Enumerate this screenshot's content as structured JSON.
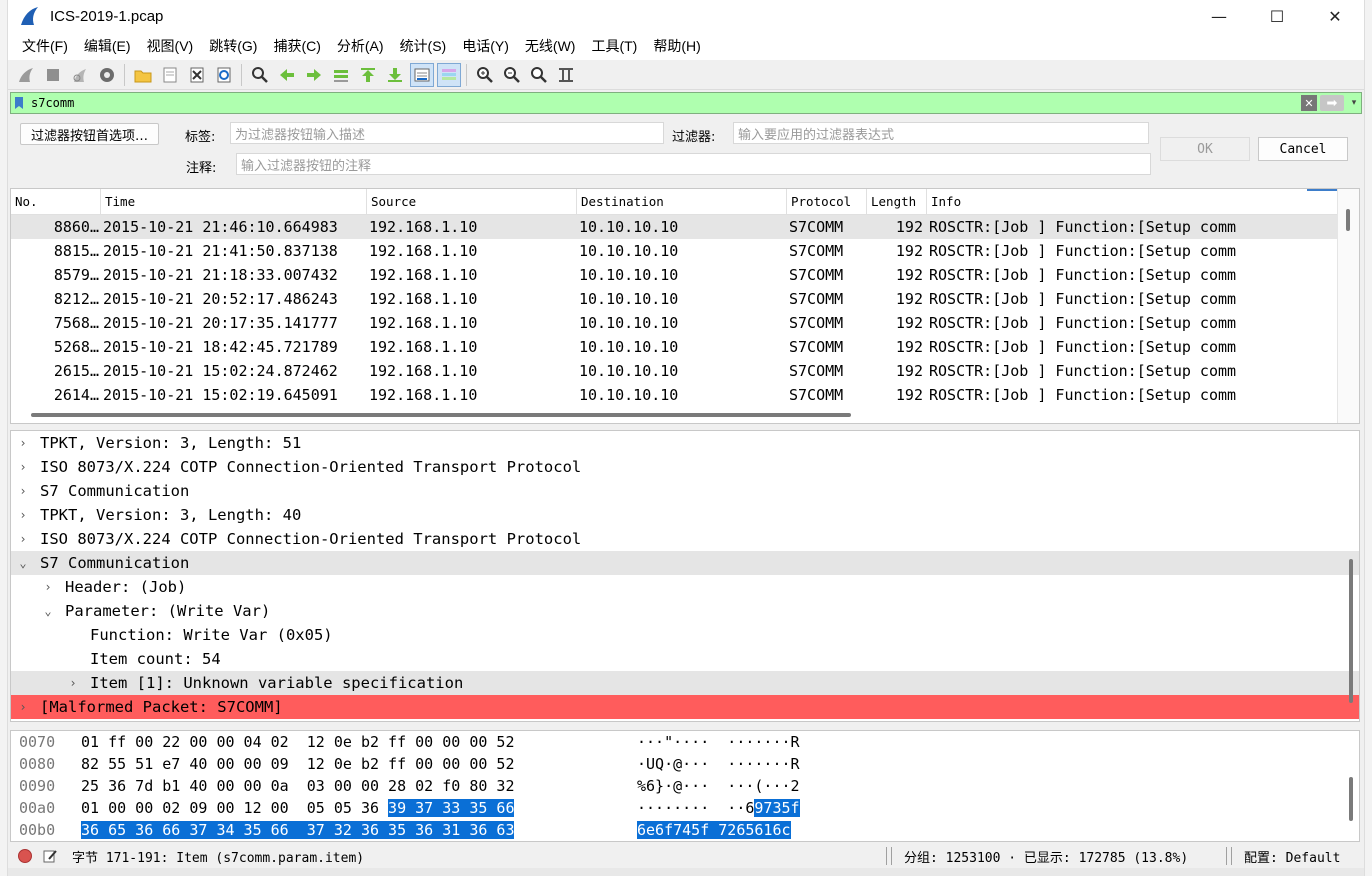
{
  "window": {
    "title": "ICS-2019-1.pcap",
    "controls": {
      "minimize": "—",
      "maximize": "☐",
      "close": "✕"
    }
  },
  "menu": [
    "文件(F)",
    "编辑(E)",
    "视图(V)",
    "跳转(G)",
    "捕获(C)",
    "分析(A)",
    "统计(S)",
    "电话(Y)",
    "无线(W)",
    "工具(T)",
    "帮助(H)"
  ],
  "toolbar": {
    "icons": [
      "shark-fin-start-icon",
      "stop-square-icon",
      "restart-fin-icon",
      "capture-options-gear-icon",
      "open-folder-icon",
      "file-icon",
      "close-file-icon",
      "reload-icon",
      "find-magnifier-icon",
      "go-back-arrow-icon",
      "go-forward-arrow-icon",
      "go-to-packet-icon",
      "go-first-icon",
      "go-last-icon",
      "autoscroll-icon",
      "colorize-icon",
      "zoom-in-icon",
      "zoom-out-icon",
      "zoom-normal-icon",
      "resize-columns-icon"
    ]
  },
  "filter": {
    "value": "s7comm",
    "color": "#afffaf",
    "plus": "+"
  },
  "filter_button_editor": {
    "prefs_button": "过滤器按钮首选项…",
    "label_label": "标签:",
    "label_placeholder": "为过滤器按钮输入描述",
    "filter_label": "过滤器:",
    "filter_placeholder": "输入要应用的过滤器表达式",
    "comment_label": "注释:",
    "comment_placeholder": "输入过滤器按钮的注释",
    "ok": "OK",
    "cancel": "Cancel"
  },
  "packet_list": {
    "columns": [
      "No.",
      "Time",
      "Source",
      "Destination",
      "Protocol",
      "Length",
      "Info"
    ],
    "rows": [
      {
        "no": "8860…",
        "time": "2015-10-21 21:46:10.664983",
        "src": "192.168.1.10",
        "dst": "10.10.10.10",
        "proto": "S7COMM",
        "len": "192",
        "info": "ROSCTR:[Job     ] Function:[Setup comm"
      },
      {
        "no": "8815…",
        "time": "2015-10-21 21:41:50.837138",
        "src": "192.168.1.10",
        "dst": "10.10.10.10",
        "proto": "S7COMM",
        "len": "192",
        "info": "ROSCTR:[Job     ] Function:[Setup comm"
      },
      {
        "no": "8579…",
        "time": "2015-10-21 21:18:33.007432",
        "src": "192.168.1.10",
        "dst": "10.10.10.10",
        "proto": "S7COMM",
        "len": "192",
        "info": "ROSCTR:[Job     ] Function:[Setup comm"
      },
      {
        "no": "8212…",
        "time": "2015-10-21 20:52:17.486243",
        "src": "192.168.1.10",
        "dst": "10.10.10.10",
        "proto": "S7COMM",
        "len": "192",
        "info": "ROSCTR:[Job     ] Function:[Setup comm"
      },
      {
        "no": "7568…",
        "time": "2015-10-21 20:17:35.141777",
        "src": "192.168.1.10",
        "dst": "10.10.10.10",
        "proto": "S7COMM",
        "len": "192",
        "info": "ROSCTR:[Job     ] Function:[Setup comm"
      },
      {
        "no": "5268…",
        "time": "2015-10-21 18:42:45.721789",
        "src": "192.168.1.10",
        "dst": "10.10.10.10",
        "proto": "S7COMM",
        "len": "192",
        "info": "ROSCTR:[Job     ] Function:[Setup comm"
      },
      {
        "no": "2615…",
        "time": "2015-10-21 15:02:24.872462",
        "src": "192.168.1.10",
        "dst": "10.10.10.10",
        "proto": "S7COMM",
        "len": "192",
        "info": "ROSCTR:[Job     ] Function:[Setup comm"
      },
      {
        "no": "2614…",
        "time": "2015-10-21 15:02:19.645091",
        "src": "192.168.1.10",
        "dst": "10.10.10.10",
        "proto": "S7COMM",
        "len": "192",
        "info": "ROSCTR:[Job     ] Function:[Setup comm"
      }
    ]
  },
  "packet_details": [
    {
      "text": "TPKT, Version: 3, Length: 51",
      "arrow": "›",
      "indent": 0
    },
    {
      "text": "ISO 8073/X.224 COTP Connection-Oriented Transport Protocol",
      "arrow": "›",
      "indent": 0
    },
    {
      "text": "S7 Communication",
      "arrow": "›",
      "indent": 0
    },
    {
      "text": "TPKT, Version: 3, Length: 40",
      "arrow": "›",
      "indent": 0
    },
    {
      "text": "ISO 8073/X.224 COTP Connection-Oriented Transport Protocol",
      "arrow": "›",
      "indent": 0
    },
    {
      "text": "S7 Communication",
      "arrow": "⌄",
      "indent": 0,
      "state": "sel"
    },
    {
      "text": "Header: (Job)",
      "arrow": "›",
      "indent": 1
    },
    {
      "text": "Parameter: (Write Var)",
      "arrow": "⌄",
      "indent": 1
    },
    {
      "text": "Function: Write Var (0x05)",
      "arrow": "",
      "indent": 2
    },
    {
      "text": "Item count: 54",
      "arrow": "",
      "indent": 2
    },
    {
      "text": "Item [1]: Unknown variable specification",
      "arrow": "›",
      "indent": 2,
      "state": "sel"
    },
    {
      "text": "[Malformed Packet: S7COMM]",
      "arrow": "›",
      "indent": 0,
      "state": "malformed"
    }
  ],
  "packet_bytes": [
    {
      "off": "0070",
      "hex_a": "01 ff 00 22 00 00 04 02  12 0e b2 ff 00 00 00 52",
      "hex_b": "",
      "asc_a": "···\"····  ·······R",
      "asc_b": ""
    },
    {
      "off": "0080",
      "hex_a": "82 55 51 e7 40 00 00 09  12 0e b2 ff 00 00 00 52",
      "hex_b": "",
      "asc_a": "·UQ·@···  ·······R",
      "asc_b": ""
    },
    {
      "off": "0090",
      "hex_a": "25 36 7d b1 40 00 00 0a  03 00 00 28 02 f0 80 32",
      "hex_b": "",
      "asc_a": "%6}·@···  ···(···2",
      "asc_b": ""
    },
    {
      "off": "00a0",
      "hex_a": "01 00 00 02 09 00 12 00  05 05 36 ",
      "hex_b": "39 37 33 35 66",
      "asc_a": "········  ··6",
      "asc_b": "9735f"
    },
    {
      "off": "00b0",
      "hex_a": "",
      "hex_b": "36 65 36 66 37 34 35 66  37 32 36 35 36 31 36 63",
      "asc_a": "",
      "asc_b": "6e6f745f 7265616c"
    }
  ],
  "status": {
    "field": "字节 171-191: Item (s7comm.param.item)",
    "packets": "分组: 1253100 · 已显示: 172785 (13.8%)",
    "profile": "配置: Default"
  }
}
